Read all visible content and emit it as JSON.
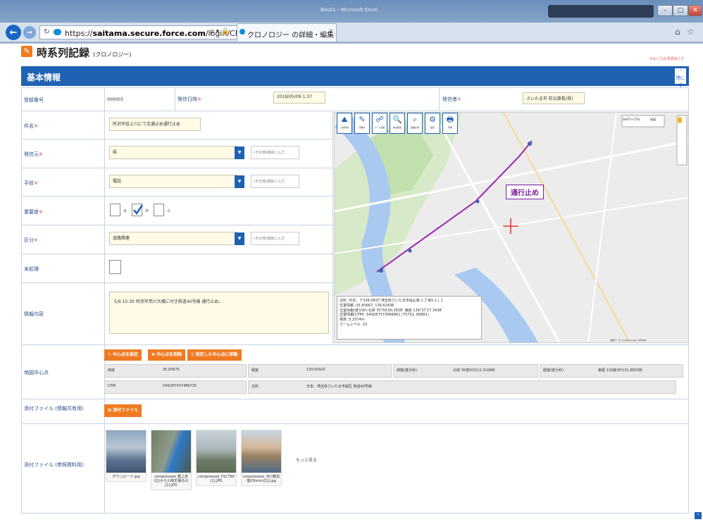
{
  "browser": {
    "window_title": "Book1 - Microsoft Excel",
    "url_prefix": "https://",
    "url_host": "saitama.secure.force.com",
    "url_path": "/login/CNG_\\",
    "tab_title": "クロノロジー の詳細・編集",
    "search_hint": "ρ ▾ 🔒"
  },
  "page": {
    "title": "時系列記録",
    "subtitle": "(クロノロジー)",
    "required_note": "※は入力必須項目です",
    "section_title": "基本情報",
    "collapse_label": "閉じる"
  },
  "form": {
    "reg_no_label": "登録番号",
    "reg_no_value": "000003",
    "date_label": "発信日時",
    "date_value": "2018/05/09 1:37",
    "sender_label": "発信者",
    "sender_value": "さいたま市 防災課長(県)",
    "subject_label": "件名",
    "subject_value": "所沢市桂上川にて交通止め通行止め",
    "source_label": "発信元",
    "source_value": "県",
    "source_free": "(その他)項目に入力",
    "means_label": "手段",
    "means_value": "電話",
    "means_free": "(その他)項目に入力",
    "priority_label": "重要度",
    "priority_opts": [
      "大",
      "中",
      "小"
    ],
    "category_label": "区分",
    "category_value": "道路関連",
    "category_free": "(その他)項目に入力",
    "unresolved_label": "未処理",
    "content_label": "情報内容",
    "content_value": "5/9 10:30  所沢市荒川大橋に付き県道40号線  通行止め。",
    "geo_label": "地図中心点",
    "geo_btn1": "中心点を設定",
    "geo_btn2": "中心点を削除",
    "geo_btn3": "指定した中心点に移動",
    "lat_label": "緯度",
    "lat_value": "35.83675",
    "lng_label": "経度",
    "lng_value": "139.60925",
    "lat_dms_label": "緯度(度分秒)",
    "lat_dms_value": "北緯 35度50分12.3108秒",
    "lng_dms_label": "経度(度分秒)",
    "lng_dms_value": "東経 139度36分32.8833秒",
    "utm_label": "UTM",
    "utm_value": "54SUE7437486735",
    "addr_label": "住所",
    "addr_value": "日本、埼玉県さいたま市桜区 県道40号線",
    "attach1_label": "添付ファイル (情報共有用)",
    "attach_btn": "添付ファイル",
    "attach2_label": "添付ファイル (参照資料用)",
    "more_link": "もっと見る"
  },
  "map": {
    "tools": [
      {
        "icon": "⛰",
        "label": "土地利用"
      },
      {
        "icon": "✎",
        "label": "手書き"
      },
      {
        "icon": "☍",
        "label": "ルート編集"
      },
      {
        "icon": "🔍",
        "label": "地点検索"
      },
      {
        "icon": "⌕",
        "label": "距離計測"
      },
      {
        "icon": "⚙",
        "label": "設定"
      },
      {
        "icon": "🖶",
        "label": "印刷"
      }
    ],
    "road_closed_label": "通行止め",
    "map_type": "地図",
    "shortcut": "SHIFT+CTRL",
    "info": [
      "住所     :日本、〒336-0837 埼玉県さいたま市桜区南 1 丁目5-1 ( 1",
      "位置情報     :35.83667, 139.62436",
      "位置情報(度分秒):北緯 35°50′00.2828″ 東経 139°37′27.3438″",
      "位置情報(UTM) :54SUE7573966861 (75752, 66861)",
      "標高         :5.2574m",
      "ズームレベル   :15"
    ],
    "attribution": "地図データ ©2018 Google, ZENRIN"
  },
  "attachments": [
    {
      "name": "ダウンロード.jpg",
      "color": "#6a86a8"
    },
    {
      "name": "compressed_橋上流 (左)から川岸を撮る(I) [1].JPG",
      "color": "#5b6b55"
    },
    {
      "name": "compressed_P1CT60 [1].JPG",
      "color": "#7c8a70"
    },
    {
      "name": "compressed_河川敷処理(Ohmin)[1].jpg",
      "color": "#8b6b4a"
    }
  ]
}
